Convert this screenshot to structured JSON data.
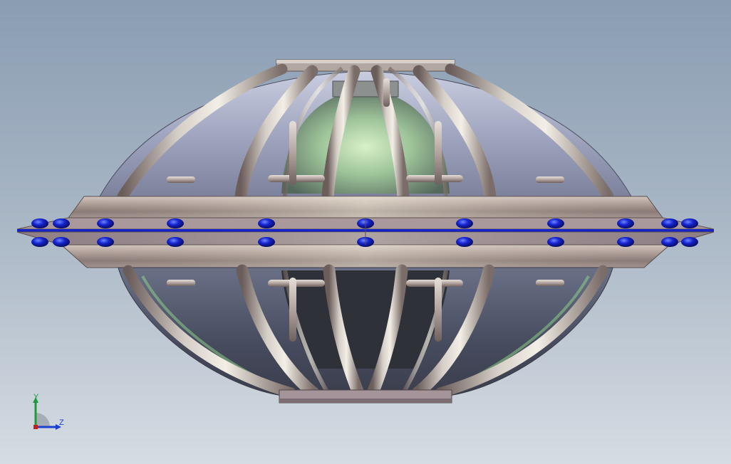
{
  "viewport": {
    "background_top": "#8a9db3",
    "background_bottom": "#d6dce3"
  },
  "model": {
    "frame_color": "#b8aaa4",
    "frame_shadow": "#6f6461",
    "shell_color": "#9aa0ba",
    "inner_glow": "#9fd39a",
    "rivet_color": "#1522c8"
  },
  "triad": {
    "y_label": "Y",
    "z_label": "Z",
    "y_color": "#1f9a3a",
    "z_color": "#1d3fd0",
    "x_color": "#c02020"
  }
}
